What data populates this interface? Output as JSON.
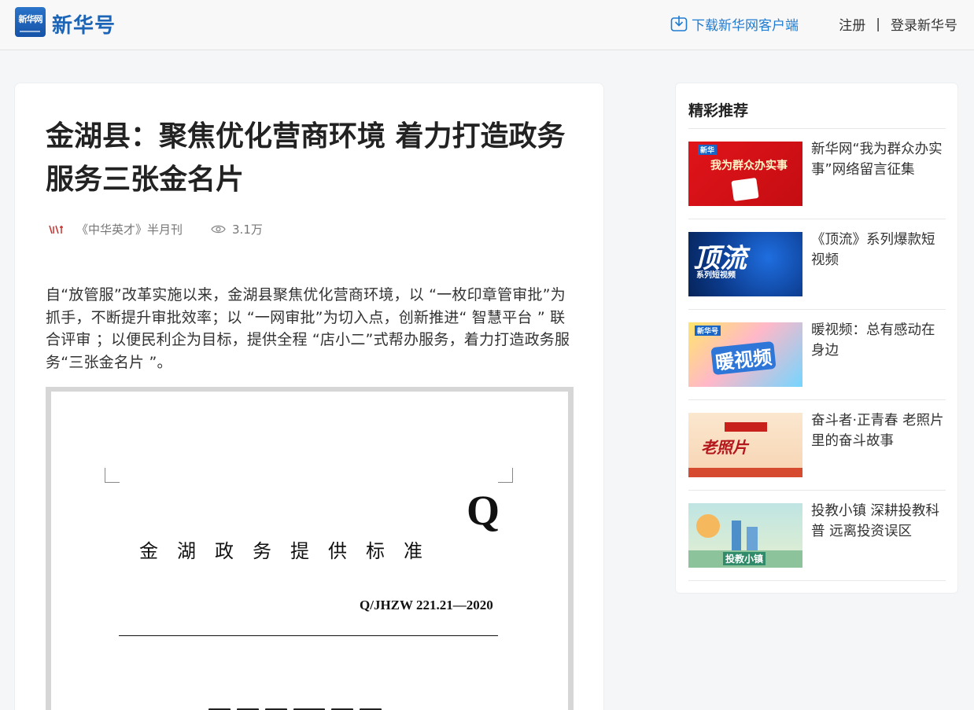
{
  "header": {
    "logo_badge": "新华网",
    "logo_text": "新华号",
    "download_label": "下载新华网客户端",
    "register_label": "注册",
    "separator": "|",
    "login_label": "登录新华号",
    "accent_color": "#1f7bd1"
  },
  "article": {
    "title": "金湖县：聚焦优化营商环境 着力打造政务服务三张金名片",
    "source": "《中华英才》半月刊",
    "views": "3.1万",
    "paragraph": "自“放管服”改革实施以来，金湖县聚焦优化营商环境，以 “一枚印章管审批”为抓手，不断提升审批效率；以 “一网审批”为切入点，创新推进“ 智慧平台 ” 联合评审 ；以便民利企为目标，提供全程 “店小二”式帮办服务，着力打造政务服务“三张金名片 ”。",
    "document": {
      "letter": "Q",
      "heading": "金湖政务提供标准",
      "code": "Q/JHZW 221.21—2020"
    }
  },
  "sidebar": {
    "title": "精彩推荐",
    "items": [
      {
        "title": "新华网“我为群众办实事”网络留言征集",
        "thumb_text": "我为群众办实事",
        "icon": "thumbnail-image"
      },
      {
        "title": "《顶流》系列爆款短视频",
        "thumb_text": "顶流",
        "thumb_sub": "系列短视频",
        "icon": "thumbnail-image"
      },
      {
        "title": "暖视频：总有感动在身边",
        "thumb_text": "暖视频",
        "icon": "thumbnail-image"
      },
      {
        "title": "奋斗者·正青春 老照片里的奋斗故事",
        "thumb_text": "老照片",
        "icon": "thumbnail-image"
      },
      {
        "title": "投教小镇 深耕投教科普 远离投资误区",
        "thumb_text": "投教小镇",
        "icon": "thumbnail-image"
      }
    ]
  }
}
